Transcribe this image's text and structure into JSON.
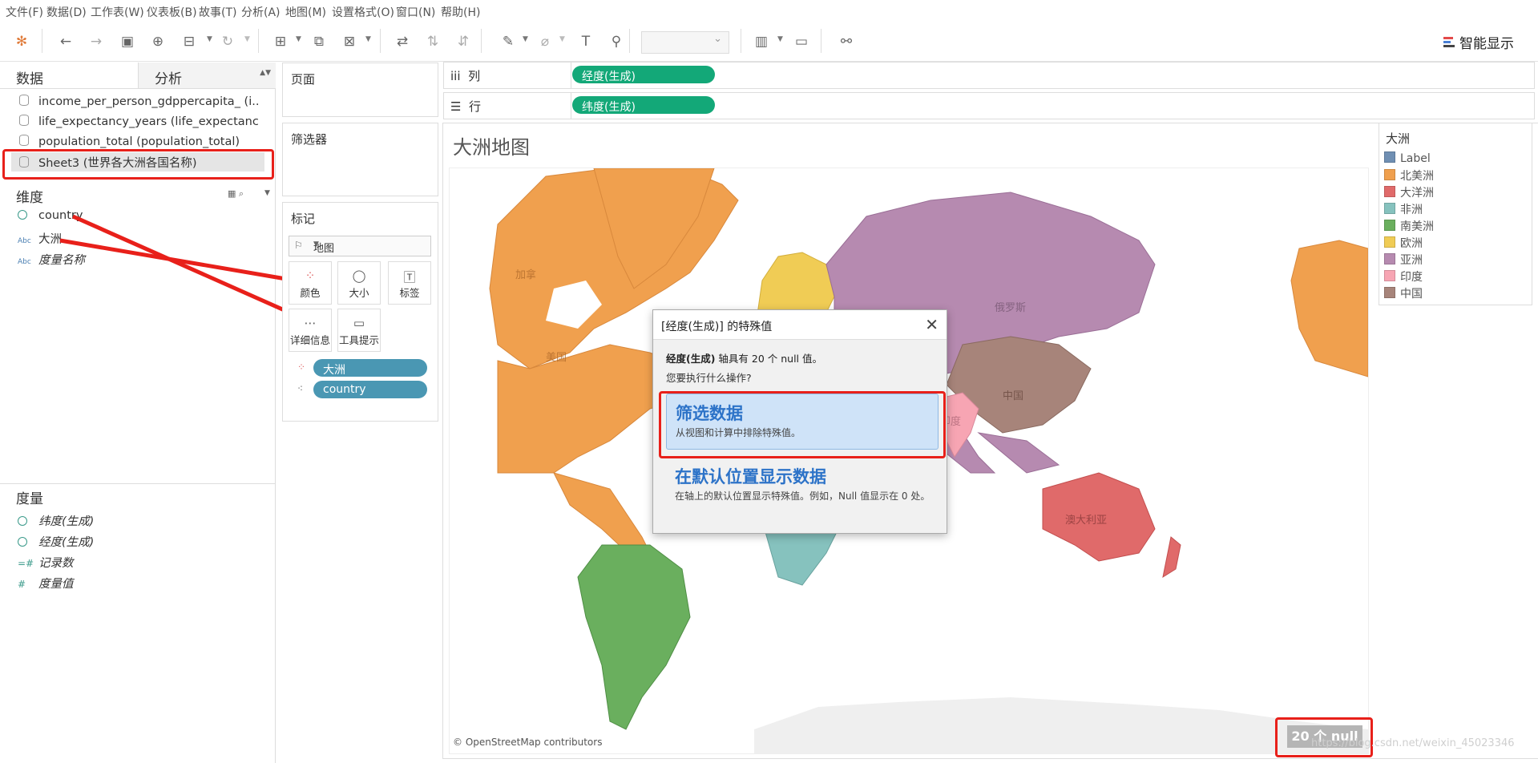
{
  "menu": [
    "文件(F)",
    "数据(D)",
    "工作表(W)",
    "仪表板(B)",
    "故事(T)",
    "分析(A)",
    "地图(M)",
    "设置格式(O)",
    "窗口(N)",
    "帮助(H)"
  ],
  "toolbar": {
    "smart_show": "智能显示"
  },
  "left": {
    "tab_data": "数据",
    "tab_analysis": "分析",
    "sources": [
      "income_per_person_gdppercapita_ (i...",
      "life_expectancy_years (life_expectanc...",
      "population_total (population_total)",
      "Sheet3 (世界各大洲各国名称)"
    ],
    "dimensions_title": "维度",
    "dimensions": [
      {
        "type": "globe",
        "name": "country"
      },
      {
        "type": "Abc",
        "name": "大洲"
      },
      {
        "type": "Abc",
        "name": "度量名称"
      }
    ],
    "measures_title": "度量",
    "measures": [
      {
        "type": "globe",
        "name": "纬度(生成)"
      },
      {
        "type": "globe",
        "name": "经度(生成)"
      },
      {
        "type": "=#",
        "name": "记录数"
      },
      {
        "type": "#",
        "name": "度量值"
      }
    ]
  },
  "shelves": {
    "pages": "页面",
    "filters": "筛选器",
    "marks": "标记",
    "mark_type": "地图",
    "mark_buttons": [
      "颜色",
      "大小",
      "标签",
      "详细信息",
      "工具提示"
    ],
    "mark_pills": [
      "大洲",
      "country"
    ],
    "columns_label": "列",
    "rows_label": "行",
    "columns_pill": "经度(生成)",
    "rows_pill": "纬度(生成)"
  },
  "view": {
    "title": "大洲地图",
    "attribution": "© OpenStreetMap contributors",
    "null_badge": "20 个 null",
    "map_labels": [
      "加拿",
      "美国",
      "俄罗斯",
      "中国",
      "印度",
      "澳大利亚"
    ]
  },
  "legend": {
    "title": "大洲",
    "items": [
      {
        "name": "Label",
        "color": "#6f8fb3"
      },
      {
        "name": "北美洲",
        "color": "#f0a04e"
      },
      {
        "name": "大洋洲",
        "color": "#e06a6a"
      },
      {
        "name": "非洲",
        "color": "#86c2be"
      },
      {
        "name": "南美洲",
        "color": "#6aaf5e"
      },
      {
        "name": "欧洲",
        "color": "#f0cc55"
      },
      {
        "name": "亚洲",
        "color": "#b68ab0"
      },
      {
        "name": "印度",
        "color": "#f7a5b3"
      },
      {
        "name": "中国",
        "color": "#a7847a"
      }
    ]
  },
  "dialog": {
    "title": "[经度(生成)] 的特殊值",
    "message_bold": "经度(生成)",
    "message_rest": " 轴具有 20 个 null 值。",
    "question": "您要执行什么操作?",
    "option1_title": "筛选数据",
    "option1_desc": "从视图和计算中排除特殊值。",
    "option2_title": "在默认位置显示数据",
    "option2_desc": "在轴上的默认位置显示特殊值。例如，Null 值显示在 0 处。"
  },
  "watermark": "https://blog.csdn.net/weixin_45023346"
}
